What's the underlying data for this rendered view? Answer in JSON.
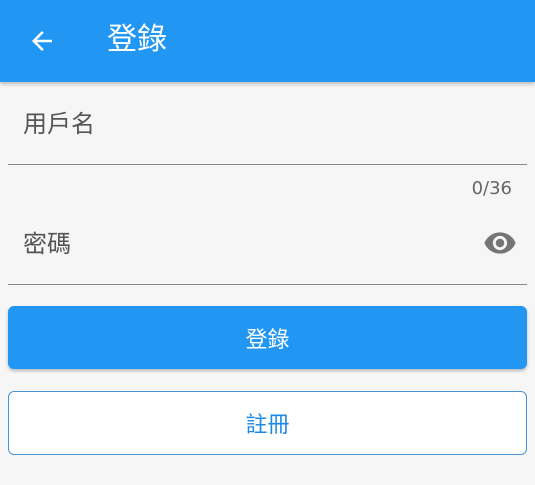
{
  "app_bar": {
    "title": "登錄",
    "back_icon": "arrow-left-icon",
    "background": "#2196f3"
  },
  "form": {
    "username": {
      "placeholder": "用戶名",
      "value": "",
      "counter": "0/36"
    },
    "password": {
      "placeholder": "密碼",
      "value": "",
      "toggle_icon": "eye-icon"
    }
  },
  "buttons": {
    "login_label": "登錄",
    "register_label": "註冊"
  },
  "colors": {
    "accent": "#2196f3",
    "outline": "#4a95d8"
  }
}
